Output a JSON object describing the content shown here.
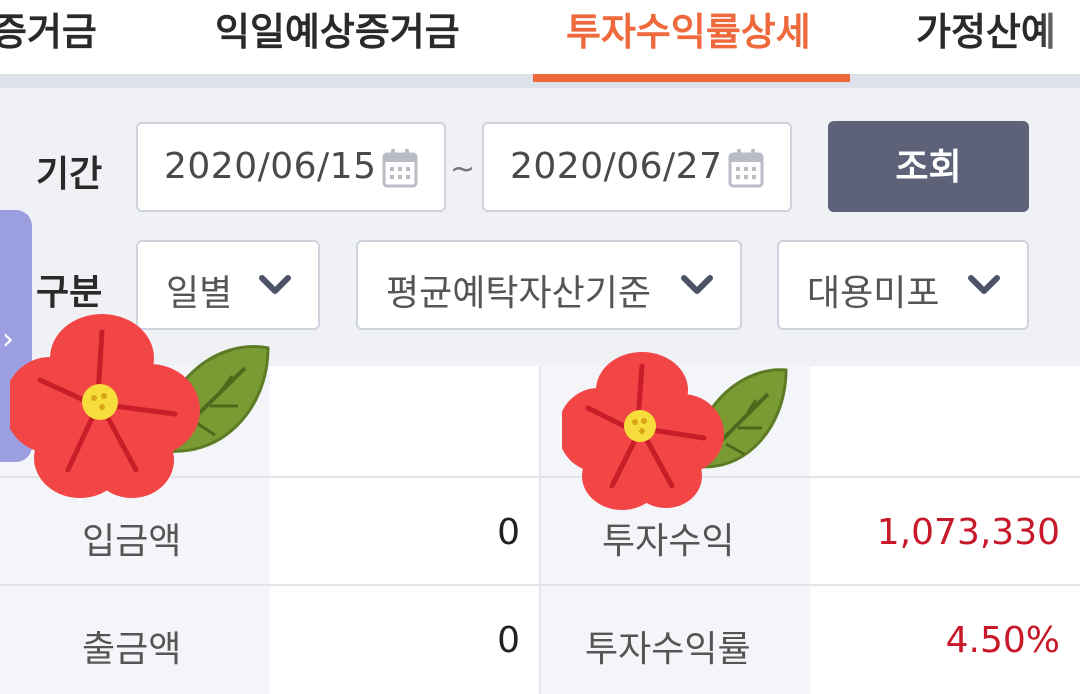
{
  "tabs": [
    {
      "label": "증거금"
    },
    {
      "label": "익일예상증거금"
    },
    {
      "label": "투자수익률상세",
      "active": true
    },
    {
      "label": "가정산예"
    }
  ],
  "colors": {
    "accent": "#ee6a3c",
    "button": "#5e6279",
    "negative_red": "#c8192a",
    "drawer": "#9b9fe0"
  },
  "filter": {
    "period_label": "기간",
    "start_date": "2020/06/15",
    "range_sep": "~",
    "end_date": "2020/06/27",
    "search_button": "조회",
    "category_label": "구분",
    "selects": [
      {
        "value": "일별"
      },
      {
        "value": "평균예탁자산기준"
      },
      {
        "value": "대용미포"
      }
    ]
  },
  "drawer": {
    "arrow": "›"
  },
  "table": {
    "rows": [
      {
        "left_label": "입금액",
        "left_value": "0",
        "right_label": "투자수익",
        "right_value": "1,073,330"
      },
      {
        "left_label": "출금액",
        "left_value": "0",
        "right_label": "투자수익률",
        "right_value": "4.50%"
      }
    ]
  },
  "icons": [
    "calendar-icon",
    "chevron-down-icon",
    "flower-sticker"
  ]
}
